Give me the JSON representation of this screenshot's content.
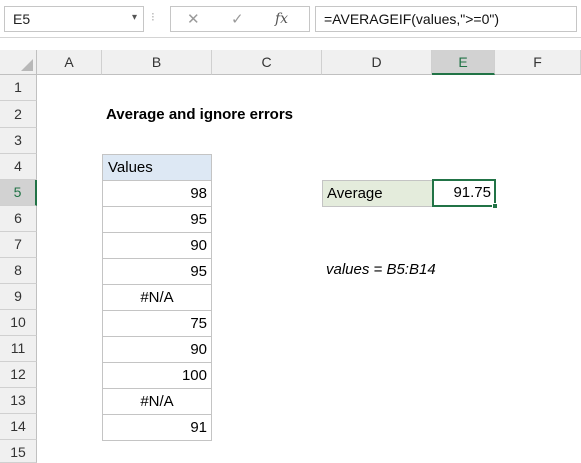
{
  "formula_bar": {
    "name_box": "E5",
    "name_arrow": "▾",
    "separator": "⁝",
    "cancel_glyph": "✕",
    "enter_glyph": "✓",
    "fx_glyph": "fx",
    "formula": "=AVERAGEIF(values,\">=0\")"
  },
  "columns": [
    "A",
    "B",
    "C",
    "D",
    "E",
    "F"
  ],
  "selected_column": "E",
  "rows": [
    "1",
    "2",
    "3",
    "4",
    "5",
    "6",
    "7",
    "8",
    "9",
    "10",
    "11",
    "12",
    "13",
    "14",
    "15"
  ],
  "selected_row": "5",
  "sheet": {
    "title": "Average and ignore errors",
    "values_header": "Values",
    "values": [
      "98",
      "95",
      "90",
      "95",
      "#N/A",
      "75",
      "90",
      "100",
      "#N/A",
      "91"
    ],
    "average_label": "Average",
    "average_value": "91.75",
    "named_range_note": "values = B5:B14"
  },
  "colors": {
    "accent": "#217346",
    "header_fill": "#dde8f4",
    "label_fill": "#e4ecdc"
  }
}
